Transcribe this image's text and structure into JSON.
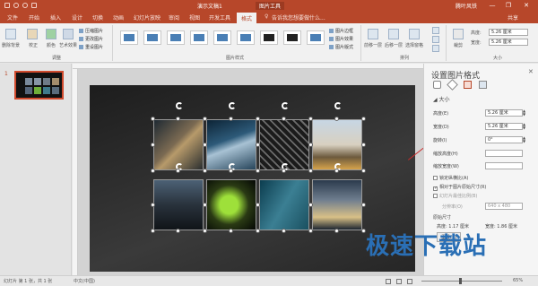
{
  "window": {
    "title": "演示文稿1",
    "context_tab": "图片工具",
    "account": "腾叶风铁",
    "controls": [
      "—",
      "❐",
      "✕"
    ]
  },
  "tabs": [
    "文件",
    "开始",
    "插入",
    "设计",
    "切换",
    "动画",
    "幻灯片放映",
    "审阅",
    "视图",
    "开发工具",
    "格式"
  ],
  "tell_me": "告诉我您想要做什么...",
  "share": "共享",
  "ribbon": {
    "adjust": {
      "buttons": [
        "删除背景",
        "校正",
        "颜色",
        "艺术效果"
      ],
      "small": [
        "压缩图片",
        "更改图片",
        "重设图片"
      ],
      "group_label": "调整"
    },
    "styles": {
      "group_label": "图片样式",
      "small": [
        "图片边框",
        "图片效果",
        "图片版式"
      ]
    },
    "arrange": {
      "group_label": "排列",
      "buttons": [
        "前移一层",
        "后移一层",
        "选择窗格"
      ]
    },
    "size": {
      "group_label": "大小",
      "crop": "裁剪",
      "height_label": "高度:",
      "height": "5.26 厘米",
      "width_label": "宽度:",
      "width": "5.26 厘米"
    }
  },
  "slide_panel": {
    "number": "1"
  },
  "pane": {
    "title": "设置图片格式",
    "section": "大小",
    "height_label": "高度(E)",
    "height": "5.26 厘米",
    "width_label": "宽度(D)",
    "width": "5.26 厘米",
    "rotation_label": "旋转(I)",
    "rotation": "0°",
    "scale_h_label": "缩放高度(H)",
    "scale_w_label": "缩放宽度(W)",
    "lock_ratio": "锁定纵横比(A)",
    "relative": "相对于图片原始尺寸(R)",
    "best_scale": "幻灯片最佳比例(B)",
    "resolution_label": "分辨率(O)",
    "resolution": "640 x 480",
    "original_size": "原始尺寸",
    "orig_height": "高度:  1.17 厘米",
    "orig_width": "宽度:  1.86 厘米",
    "reset": "重设(S)"
  },
  "status": {
    "slide": "幻灯片 第 1 张，共 1 张",
    "lang": "中文(中国)",
    "zoom": "65%"
  },
  "watermark": "极速下载站",
  "colors": {
    "accent": "#b7472a",
    "selection": "#d04a2d"
  }
}
